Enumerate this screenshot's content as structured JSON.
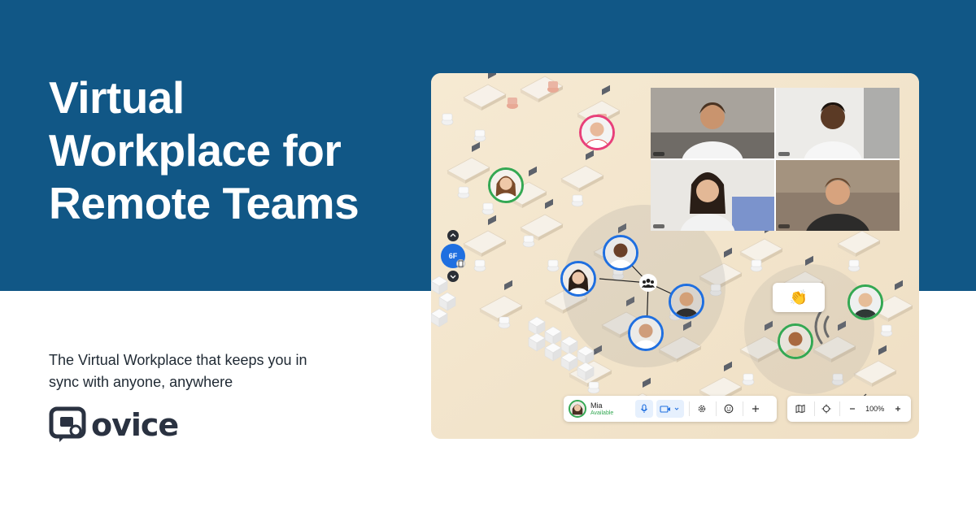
{
  "headline": {
    "line1": "Virtual",
    "line2": "Workplace for",
    "line3": "Remote Teams"
  },
  "subtitle": {
    "line1": "The Virtual Workplace that keeps you in",
    "line2": "sync with anyone, anywhere"
  },
  "logo": {
    "text": "ovice",
    "icon": "ovice-logo-icon"
  },
  "colors": {
    "brand_blue": "#115786",
    "accent_blue": "#1f6fe0",
    "available_green": "#34a853",
    "logo_dark": "#2a3241"
  },
  "floor_selector": {
    "current": "6F",
    "up_icon": "chevron-up-icon",
    "down_icon": "chevron-down-icon",
    "building_icon": "building-icon"
  },
  "reaction": {
    "emoji": "👏"
  },
  "toolbar": {
    "user_name": "Mia",
    "user_status": "Available",
    "mic_icon": "microphone-icon",
    "camera_icon": "video-camera-icon",
    "settings_icon": "gear-icon",
    "emoji_icon": "smiley-icon",
    "add_icon": "plus-icon"
  },
  "mapbar": {
    "map_icon": "map-icon",
    "locate_icon": "crosshair-icon",
    "zoom_out_icon": "minus-icon",
    "zoom_level": "100%",
    "zoom_in_icon": "plus-icon"
  }
}
